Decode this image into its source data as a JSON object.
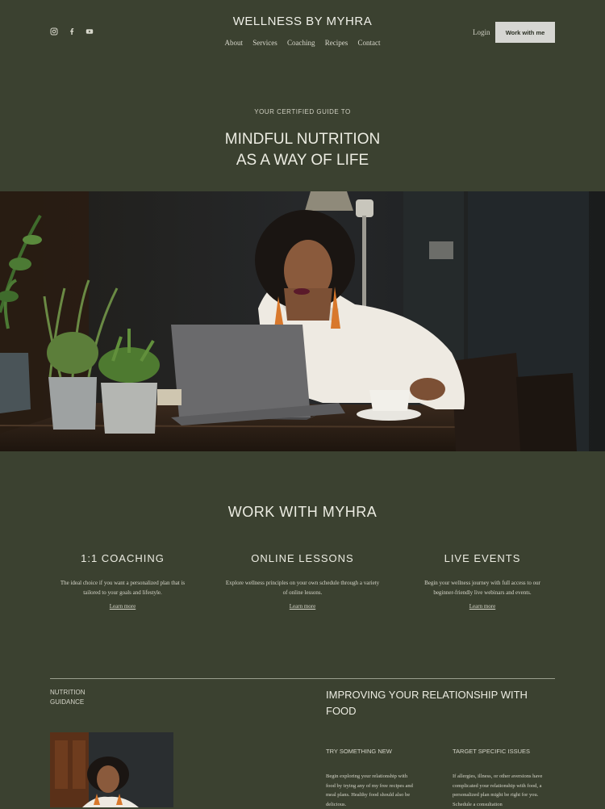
{
  "header": {
    "site_title": "WELLNESS BY MYHRA",
    "nav": [
      "About",
      "Services",
      "Coaching",
      "Recipes",
      "Contact"
    ],
    "login_label": "Login",
    "cta_label": "Work with me",
    "social_icons": [
      "instagram-icon",
      "facebook-icon",
      "youtube-icon"
    ]
  },
  "hero": {
    "pre_title": "YOUR CERTIFIED GUIDE TO",
    "title_line1": "MINDFUL NUTRITION",
    "title_line2": "AS A WAY OF LIFE"
  },
  "work": {
    "title": "WORK WITH MYHRA",
    "services": [
      {
        "title": "1:1  COACHING",
        "desc_line1": "The ideal choice if you want a personalized plan that is",
        "desc_line2": "tailored to your goals and lifestyle.",
        "link": "Learn more"
      },
      {
        "title": "ONLINE  LESSONS",
        "desc_line1": "Explore wellness principles on your own schedule through a variety",
        "desc_line2": "of online lessons.",
        "link": "Learn more"
      },
      {
        "title": "LIVE  EVENTS",
        "desc_line1": "Begin your wellness journey with full access to our",
        "desc_line2": "beginner-friendly live webinars and events.",
        "link": "Learn more"
      }
    ]
  },
  "guidance": {
    "label_line1": "NUTRITION",
    "label_line2": "GUIDANCE",
    "title_line1": "IMPROVING YOUR RELATIONSHIP WITH",
    "title_line2": "FOOD",
    "columns": [
      {
        "heading": "TRY SOMETHING NEW",
        "lines": [
          "Begin exploring your relationship with",
          "food by trying any of my free recipes and",
          "meal plans. Healthy food should also be",
          "delicious."
        ]
      },
      {
        "heading": "TARGET SPECIFIC ISSUES",
        "lines": [
          "If allergies, illness, or other aversions have",
          "complicated your relationship with food, a",
          "personalized plan might be right for you.",
          "Schedule a consultation"
        ]
      }
    ]
  },
  "colors": {
    "background": "#3b4130",
    "cta_background": "#d6d6d2",
    "text": "#e6e6dc"
  }
}
